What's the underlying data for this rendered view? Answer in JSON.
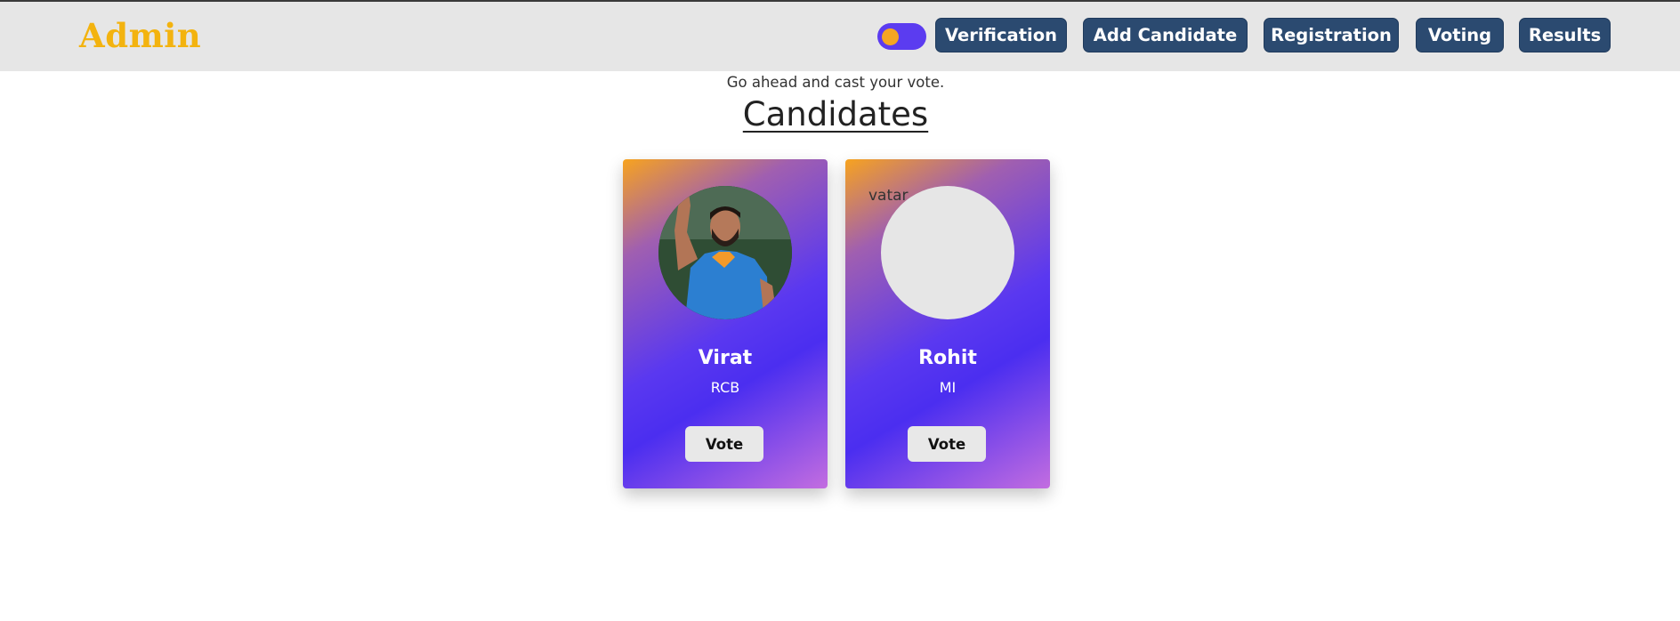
{
  "header": {
    "brand": "Admin",
    "nav": {
      "verification": "Verification",
      "add_candidate": "Add Candidate",
      "registration": "Registration",
      "voting": "Voting",
      "results": "Results"
    },
    "theme_toggle": {
      "icon": "toggle-switch",
      "on": true
    }
  },
  "main": {
    "subtitle": "Go ahead and cast your vote.",
    "title": "Candidates",
    "candidates": [
      {
        "name": "Virat",
        "party": "RCB",
        "vote_label": "Vote",
        "avatar": "photo"
      },
      {
        "name": "Rohit",
        "party": "MI",
        "vote_label": "Vote",
        "avatar_alt": "vatar"
      }
    ]
  },
  "colors": {
    "brand": "#f3b30f",
    "nav_button": "#2b4a70",
    "navbar_bg": "#e6e6e6",
    "toggle_bg": "#5b3cf0",
    "toggle_knob": "#f5a623",
    "card_gradient_start": "#f7a31f",
    "card_gradient_mid": "#4b2ef0",
    "card_gradient_end": "#c36de0"
  }
}
